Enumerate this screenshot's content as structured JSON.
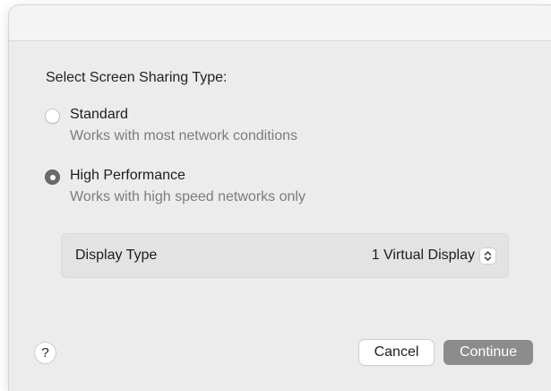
{
  "dialog": {
    "heading": "Select Screen Sharing Type:",
    "options": [
      {
        "label": "Standard",
        "description": "Works with most network conditions",
        "selected": false
      },
      {
        "label": "High Performance",
        "description": "Works with high speed networks only",
        "selected": true
      }
    ],
    "display_type": {
      "label": "Display Type",
      "value": "1 Virtual Display",
      "icon": "stepper-chevron-icon"
    },
    "help_label": "?",
    "buttons": {
      "cancel": "Cancel",
      "continue": "Continue"
    }
  },
  "colors": {
    "window_bg": "#ececec",
    "selected_radio": "#6b6b6b",
    "continue_button": "#8c8c8c",
    "secondary_text": "#7c7c7c"
  }
}
